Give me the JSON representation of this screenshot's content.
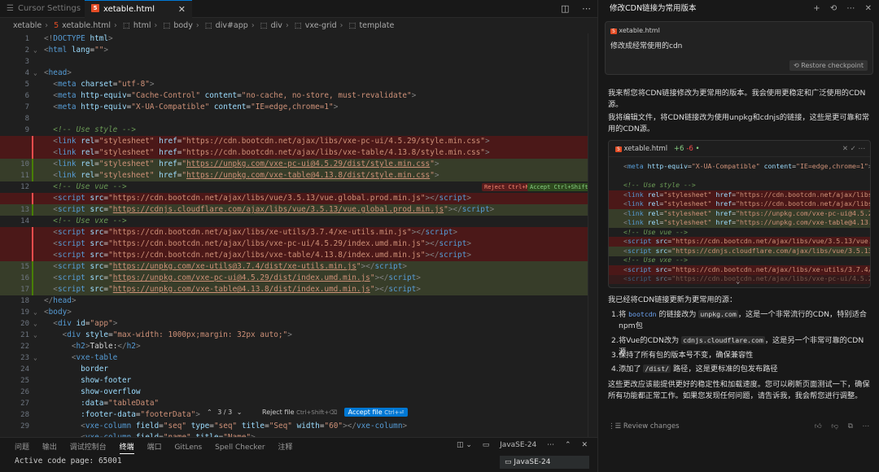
{
  "tabs": [
    {
      "label": "Cursor Settings"
    },
    {
      "label": "xetable.html"
    }
  ],
  "breadcrumb": [
    "xetable",
    "xetable.html",
    "html",
    "body",
    "div#app",
    "div",
    "vxe-grid",
    "template"
  ],
  "editor": {
    "line_numbers": [
      "1",
      "2",
      "3",
      "4",
      "5",
      "6",
      "7",
      "8",
      "9",
      "",
      "",
      "10",
      "11",
      "12",
      "",
      "13",
      "14",
      "",
      "",
      "",
      "15",
      "16",
      "17",
      "18",
      "19",
      "20",
      "21",
      "22",
      "23",
      "24",
      "25",
      "26",
      "27",
      "28",
      "29"
    ],
    "inline_actions": {
      "reject": "Reject Ctrl+N",
      "accept": "Accept Ctrl+Shift+Y"
    },
    "diff_widget": {
      "counter": "3 / 3",
      "reject": "Reject file",
      "reject_shortcut": "Ctrl+Shift+⌫",
      "accept": "Accept file",
      "accept_shortcut": "Ctrl+⏎"
    }
  },
  "panel": {
    "tabs": [
      "问题",
      "输出",
      "调试控制台",
      "终端",
      "端口",
      "GitLens",
      "Spell Checker",
      "注释"
    ],
    "active_tab": "终端",
    "terminal_text": "Active code page: 65001",
    "shell": "JavaSE-24",
    "terminal_tab": "JavaSE-24"
  },
  "chat": {
    "title": "修改CDN链接为常用版本",
    "user_file": "xetable.html",
    "user_message": "修改成经常使用的cdn",
    "restore_label": "Restore checkpoint",
    "intro": "我来帮您将CDN链接修改为更常用的版本。我会使用更稳定和广泛使用的CDN源。",
    "intro2": "我将编辑文件，将CDN链接改为使用unpkg和cdnjs的链接，这些是更可靠和常用的CDN源。",
    "card": {
      "file": "xetable.html",
      "added": "+6",
      "removed": "-6"
    },
    "done": "我已经将CDN链接更新为更常用的源：",
    "list": [
      {
        "n": "1.",
        "pre": "将",
        "chip1": "bootcdn",
        "mid": "的链接改为",
        "chip2": "unpkg.com",
        "post": "，这是一个非常流行的CDN，特别适合npm包"
      },
      {
        "n": "2.",
        "pre": "将Vue的CDN改为",
        "chip2": "cdnjs.cloudflare.com",
        "post": "，这是另一个非常可靠的CDN源"
      },
      {
        "n": "3.",
        "text": "保持了所有包的版本号不变，确保兼容性"
      },
      {
        "n": "4.",
        "pre": "添加了",
        "chip2": "/dist/",
        "post": "路径，这是更标准的包发布路径"
      }
    ],
    "outro": "这些更改应该能提供更好的稳定性和加载速度。您可以刷新页面测试一下，确保所有功能都正常工作。如果您发现任何问题，请告诉我，我会帮您进行调整。",
    "review_label": "Review changes"
  },
  "colors": {
    "accent": "#0078d4",
    "added_bg": "#373d29",
    "removed_bg": "#4b1818"
  }
}
